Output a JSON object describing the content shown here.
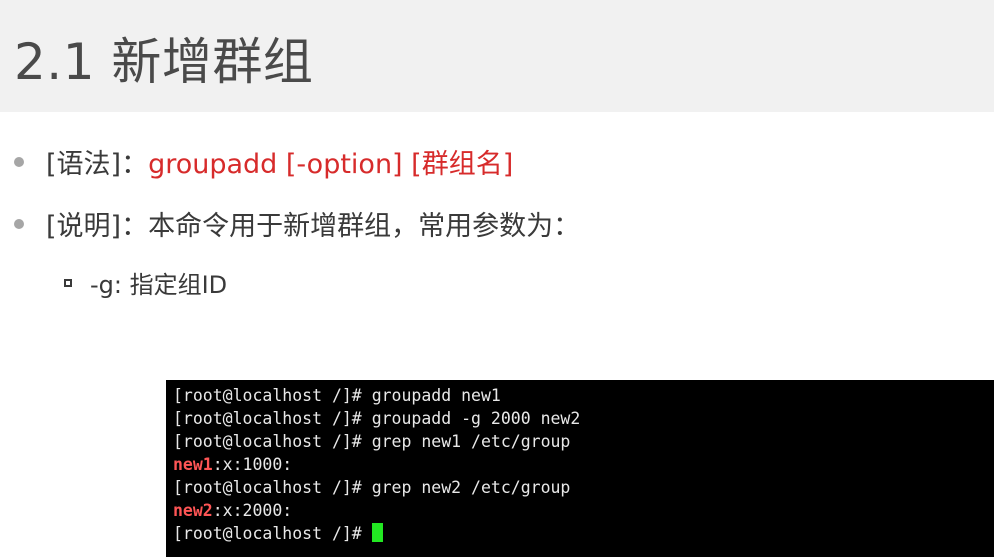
{
  "slide": {
    "title": "2.1 新增群组",
    "bullets": [
      {
        "label": "[语法]：",
        "text": "groupadd  [-option] [群组名]"
      },
      {
        "label": "[说明]：",
        "text": "本命令用于新增群组，常用参数为："
      }
    ],
    "sub_bullet": "-g: 指定组ID"
  },
  "terminal": {
    "prompt": "[root@localhost /]# ",
    "lines": [
      {
        "cmd": "groupadd new1"
      },
      {
        "cmd": "groupadd -g 2000 new2"
      },
      {
        "cmd": "grep new1 /etc/group"
      },
      {
        "match": "new1",
        "rest": ":x:1000:"
      },
      {
        "cmd": "grep new2 /etc/group"
      },
      {
        "match": "new2",
        "rest": ":x:2000:"
      }
    ],
    "cursor_color": "#22e822",
    "match_color": "#ff5555"
  },
  "colors": {
    "syntax_red": "#d72b2b",
    "title_band": "#f1f1f1",
    "text": "#3a3a3a"
  }
}
